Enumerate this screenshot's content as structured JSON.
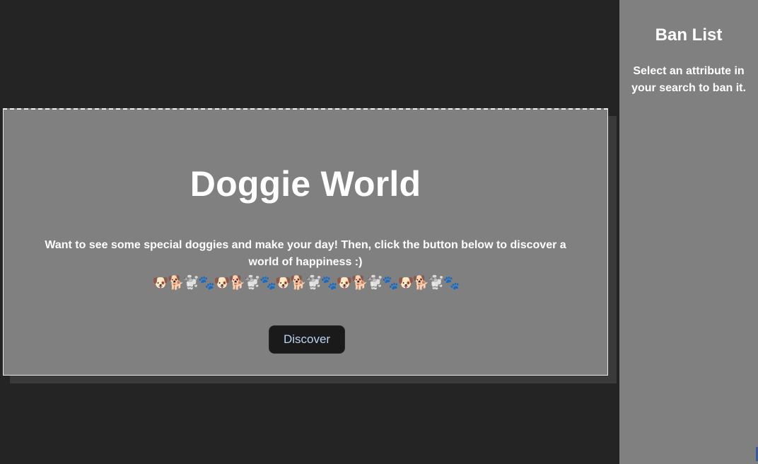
{
  "main": {
    "title": "Doggie World",
    "description": "Want to see some special doggies and make your day! Then, click the button below to discover a world of happiness :)",
    "emoji_row": "🐶🐕🐩🐾🐶🐕🐩🐾🐶🐕🐩🐾🐶🐕🐩🐾🐶🐕🐩🐾",
    "discover_label": "Discover"
  },
  "sidebar": {
    "title": "Ban List",
    "hint": "Select an attribute in your search to ban it."
  },
  "colors": {
    "page_bg": "#242424",
    "card_bg": "#808080",
    "sidebar_bg": "#808080",
    "button_bg": "#1a1a1a",
    "button_text": "#bcd2f0",
    "text": "#ffffff"
  }
}
